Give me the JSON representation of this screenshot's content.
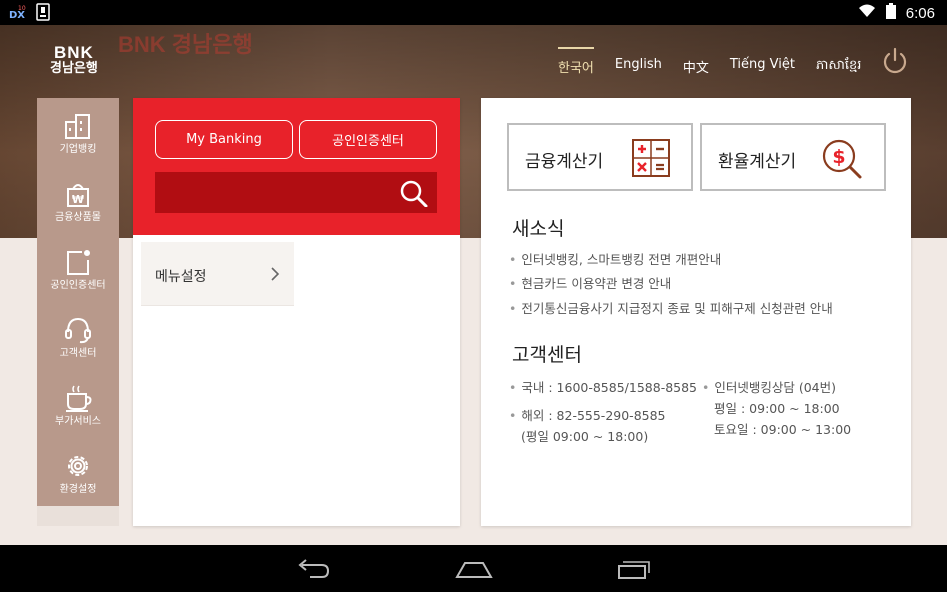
{
  "status_bar": {
    "time": "6:06"
  },
  "header": {
    "watermark": "BNK 경남은행",
    "logo_line1": "BNK",
    "logo_line2": "경남은행",
    "languages": [
      "한국어",
      "English",
      "中文",
      "Tiếng Việt",
      "ភាសាខ្មែរ"
    ],
    "active_language": "한국어"
  },
  "sidebar": {
    "items": [
      {
        "label": "기업뱅킹",
        "icon": "building-icon"
      },
      {
        "label": "금융상품몰",
        "icon": "won-bag-icon"
      },
      {
        "label": "공인인증센터",
        "icon": "certificate-icon"
      },
      {
        "label": "고객센터",
        "icon": "headset-icon"
      },
      {
        "label": "부가서비스",
        "icon": "coffee-cup-icon"
      },
      {
        "label": "환경설정",
        "icon": "gear-icon"
      }
    ]
  },
  "main_panel": {
    "my_banking_label": "My Banking",
    "cert_center_label": "공인인증센터",
    "search_value": "",
    "menu_settings_label": "메뉴설정"
  },
  "right_panel": {
    "finance_calc_label": "금융계산기",
    "exchange_calc_label": "환율계산기",
    "news_title": "새소식",
    "news": [
      "인터넷뱅킹, 스마트뱅킹 전면 개편안내",
      "현금카드 이용약관 변경 안내",
      "전기통신금융사기 지급정지 종료 및 피해구제 신청관련 안내"
    ],
    "cs_title": "고객센터",
    "cs_domestic": "국내 : 1600-8585/1588-8585",
    "cs_overseas": "해외 : 82-555-290-8585",
    "cs_overseas_hours": "(평일 09:00 ~ 18:00)",
    "cs_internet": "인터넷뱅킹상담 (04번)",
    "cs_weekday": "평일 : 09:00 ~ 18:00",
    "cs_saturday": "토요일 : 09:00 ~ 13:00"
  },
  "colors": {
    "brand_red": "#e8222a",
    "search_red": "#b10d12",
    "sidebar": "#b8998b",
    "calc_icon": "#8a3c1e"
  }
}
